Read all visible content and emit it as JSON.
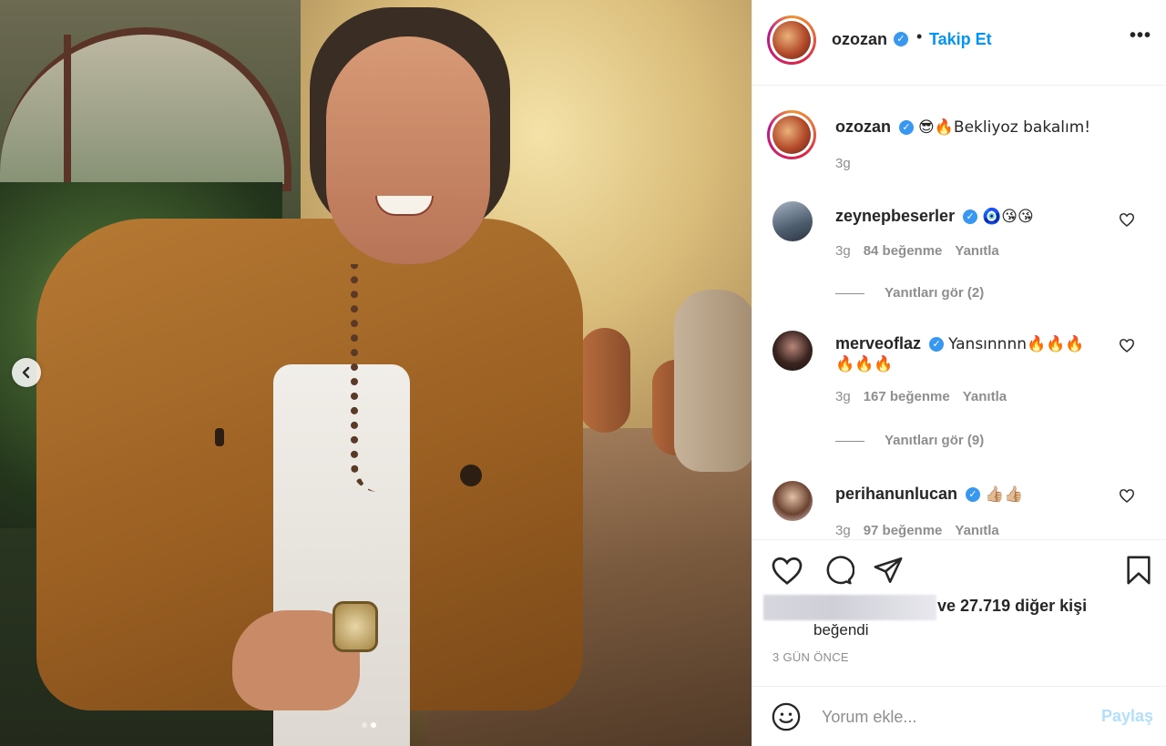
{
  "post": {
    "author": "ozozan",
    "follow_label": "Takip Et",
    "dot": "•",
    "more_label": "•••",
    "caption": {
      "username": "ozozan",
      "text": "😎🔥Bekliyoz bakalım!",
      "time": "3g"
    },
    "comments": [
      {
        "username": "zeynepbeserler",
        "text": "🧿😘😘",
        "time": "3g",
        "likes": "84 beğenme",
        "reply_label": "Yanıtla",
        "view_replies": "Yanıtları gör (2)"
      },
      {
        "username": "merveoflaz",
        "text": "Yansınnnn🔥🔥🔥",
        "text2": "🔥🔥🔥",
        "time": "3g",
        "likes": "167 beğenme",
        "reply_label": "Yanıtla",
        "view_replies": "Yanıtları gör (9)"
      },
      {
        "username": "perihanunlucan",
        "text": "👍🏼👍🏼",
        "time": "3g",
        "likes": "97 beğenme",
        "reply_label": "Yanıtla"
      }
    ],
    "likes_summary": "ve 27.719 diğer kişi",
    "likes_summary2": "beğendi",
    "time_ago": "3 GÜN ÖNCE",
    "add_comment": {
      "placeholder": "Yorum ekle...",
      "share_label": "Paylaş"
    },
    "carousel": {
      "count": 2,
      "active_index": 1
    }
  },
  "colors": {
    "link_blue": "#0095f6",
    "verified_blue": "#3897f0",
    "muted_text": "#8e8e8e",
    "share_disabled": "#b2dffc"
  },
  "icons": [
    "chevron-left-icon",
    "verified-icon",
    "heart-icon",
    "comment-icon",
    "share-icon",
    "bookmark-icon",
    "emoji-icon"
  ]
}
